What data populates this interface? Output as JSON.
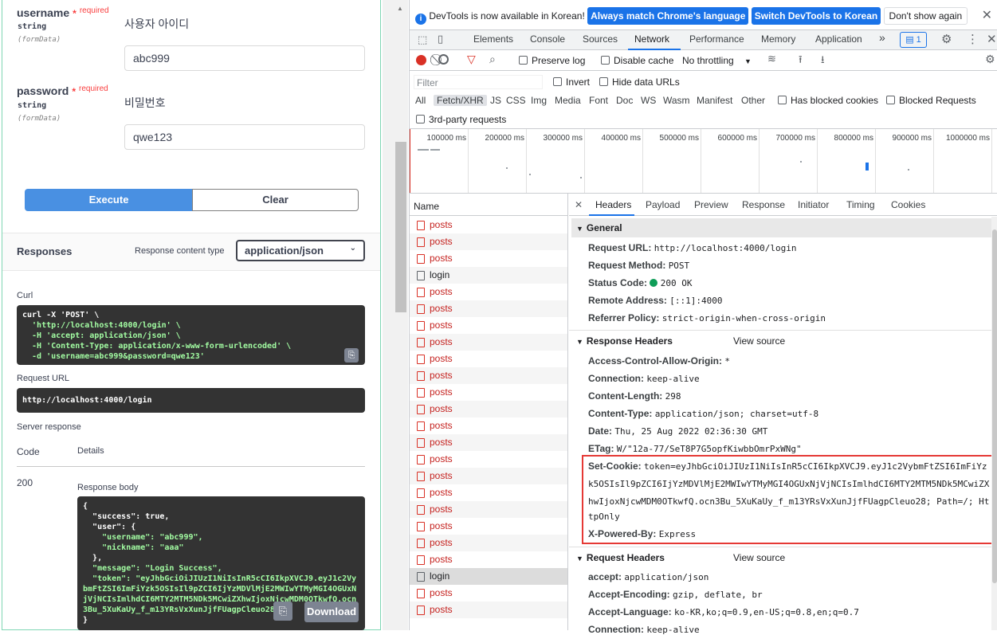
{
  "swagger": {
    "params": [
      {
        "name": "username",
        "star": "*",
        "required": "required",
        "type": "string",
        "in": "(formData)",
        "description": "사용자 아이디",
        "value": "abc999"
      },
      {
        "name": "password",
        "star": "*",
        "required": "required",
        "type": "string",
        "in": "(formData)",
        "description": "비밀번호",
        "value": "qwe123"
      }
    ],
    "execute_label": "Execute",
    "clear_label": "Clear",
    "responses_title": "Responses",
    "content_type_label": "Response content type",
    "content_type_value": "application/json",
    "curl_label": "Curl",
    "curl_lines": [
      "curl -X 'POST' \\",
      "  'http://localhost:4000/login' \\",
      "  -H 'accept: application/json' \\",
      "  -H 'Content-Type: application/x-www-form-urlencoded' \\",
      "  -d 'username=abc999&password=qwe123'"
    ],
    "request_url_label": "Request URL",
    "request_url": "http://localhost:4000/login",
    "server_response_label": "Server response",
    "code_header": "Code",
    "details_header": "Details",
    "code": "200",
    "response_body_label": "Response body",
    "body_lines": [
      "{",
      "  \"success\": true,",
      "  \"user\": {",
      "    \"username\": \"abc999\",",
      "    \"nickname\": \"aaa\"",
      "  },",
      "  \"message\": \"Login Success\",",
      "  \"token\": \"eyJhbGciOiJIUzI1NiIsInR5cCI6IkpXVCJ9.eyJ1c2VybmFtZSI6ImFiYzk5OSIsIl9pZCI6IjYzMDVlMjE2MWIwYTMyMGI4OGUxNjVjNCIsImlhdCI6MTY2MTM5NDk5MCwiZXhwIjoxNjcwMDM0OTkwfQ.ocn3Bu_5XuKaUy_f_m13YRsVxXunJjfFUagpCleuo28\"",
      "}"
    ],
    "download_label": "Download"
  },
  "devtools": {
    "notice": {
      "text": "DevTools is now available in Korean!",
      "match_label": "Always match Chrome's language",
      "switch_label": "Switch DevTools to Korean",
      "dont_show_label": "Don't show again"
    },
    "tabs": [
      "Elements",
      "Console",
      "Sources",
      "Network",
      "Performance",
      "Memory",
      "Application"
    ],
    "active_tab": "Network",
    "more_tabs": "»",
    "issues_count": "1",
    "toolbar": {
      "preserve_log": "Preserve log",
      "disable_cache": "Disable cache",
      "throttling": "No throttling"
    },
    "filter": {
      "placeholder": "Filter",
      "invert": "Invert",
      "hide_data_urls": "Hide data URLs",
      "types": [
        "All",
        "Fetch/XHR",
        "JS",
        "CSS",
        "Img",
        "Media",
        "Font",
        "Doc",
        "WS",
        "Wasm",
        "Manifest",
        "Other"
      ],
      "active_type": "Fetch/XHR",
      "blocked_cookies": "Has blocked cookies",
      "blocked_requests": "Blocked Requests",
      "third_party": "3rd-party requests"
    },
    "timeline_ticks": [
      "100000 ms",
      "200000 ms",
      "300000 ms",
      "400000 ms",
      "500000 ms",
      "600000 ms",
      "700000 ms",
      "800000 ms",
      "900000 ms",
      "1000000 ms"
    ],
    "name_header": "Name",
    "requests": [
      "posts",
      "posts",
      "posts",
      "login",
      "posts",
      "posts",
      "posts",
      "posts",
      "posts",
      "posts",
      "posts",
      "posts",
      "posts",
      "posts",
      "posts",
      "posts",
      "posts",
      "posts",
      "posts",
      "posts",
      "posts",
      "login",
      "posts",
      "posts"
    ],
    "detail_tabs": [
      "Headers",
      "Payload",
      "Preview",
      "Response",
      "Initiator",
      "Timing",
      "Cookies"
    ],
    "active_detail_tab": "Headers",
    "general": {
      "title": "General",
      "rows": [
        {
          "k": "Request URL:",
          "v": "http://localhost:4000/login"
        },
        {
          "k": "Request Method:",
          "v": "POST"
        },
        {
          "k": "Status Code:",
          "v": "200 OK"
        },
        {
          "k": "Remote Address:",
          "v": "[::1]:4000"
        },
        {
          "k": "Referrer Policy:",
          "v": "strict-origin-when-cross-origin"
        }
      ]
    },
    "response_headers": {
      "title": "Response Headers",
      "view_source": "View source",
      "rows": [
        {
          "k": "Access-Control-Allow-Origin:",
          "v": "*"
        },
        {
          "k": "Connection:",
          "v": "keep-alive"
        },
        {
          "k": "Content-Length:",
          "v": "298"
        },
        {
          "k": "Content-Type:",
          "v": "application/json; charset=utf-8"
        },
        {
          "k": "Date:",
          "v": "Thu, 25 Aug 2022 02:36:30 GMT"
        },
        {
          "k": "ETag:",
          "v": "W/\"12a-77/SeT8P7G5opfKiwbbOmrPxWNg\""
        }
      ],
      "set_cookie_key": "Set-Cookie:",
      "set_cookie_lines": [
        "token=eyJhbGciOiJIUzI1NiIsInR5cCI6IkpXVCJ9.eyJ1c2VybmFtZSI6ImFiYz",
        "k5OSIsIl9pZCI6IjYzMDVlMjE2MWIwYTMyMGI4OGUxNjVjNCIsImlhdCI6MTY2MTM5NDk5MCwiZX",
        "hwIjoxNjcwMDM0OTkwfQ.ocn3Bu_5XuKaUy_f_m13YRsVxXunJjfFUagpCleuo28; Path=/; Ht",
        "tpOnly"
      ],
      "powered_by_key": "X-Powered-By:",
      "powered_by_value": "Express"
    },
    "request_headers": {
      "title": "Request Headers",
      "view_source": "View source",
      "rows": [
        {
          "k": "accept:",
          "v": "application/json"
        },
        {
          "k": "Accept-Encoding:",
          "v": "gzip, deflate, br"
        },
        {
          "k": "Accept-Language:",
          "v": "ko-KR,ko;q=0.9,en-US;q=0.8,en;q=0.7"
        },
        {
          "k": "Connection:",
          "v": "keep-alive"
        }
      ]
    },
    "colors": {
      "accent": "#1a73e8",
      "error": "#d93025",
      "highlight_border": "#e53935",
      "status_ok": "#0f9d58"
    }
  }
}
